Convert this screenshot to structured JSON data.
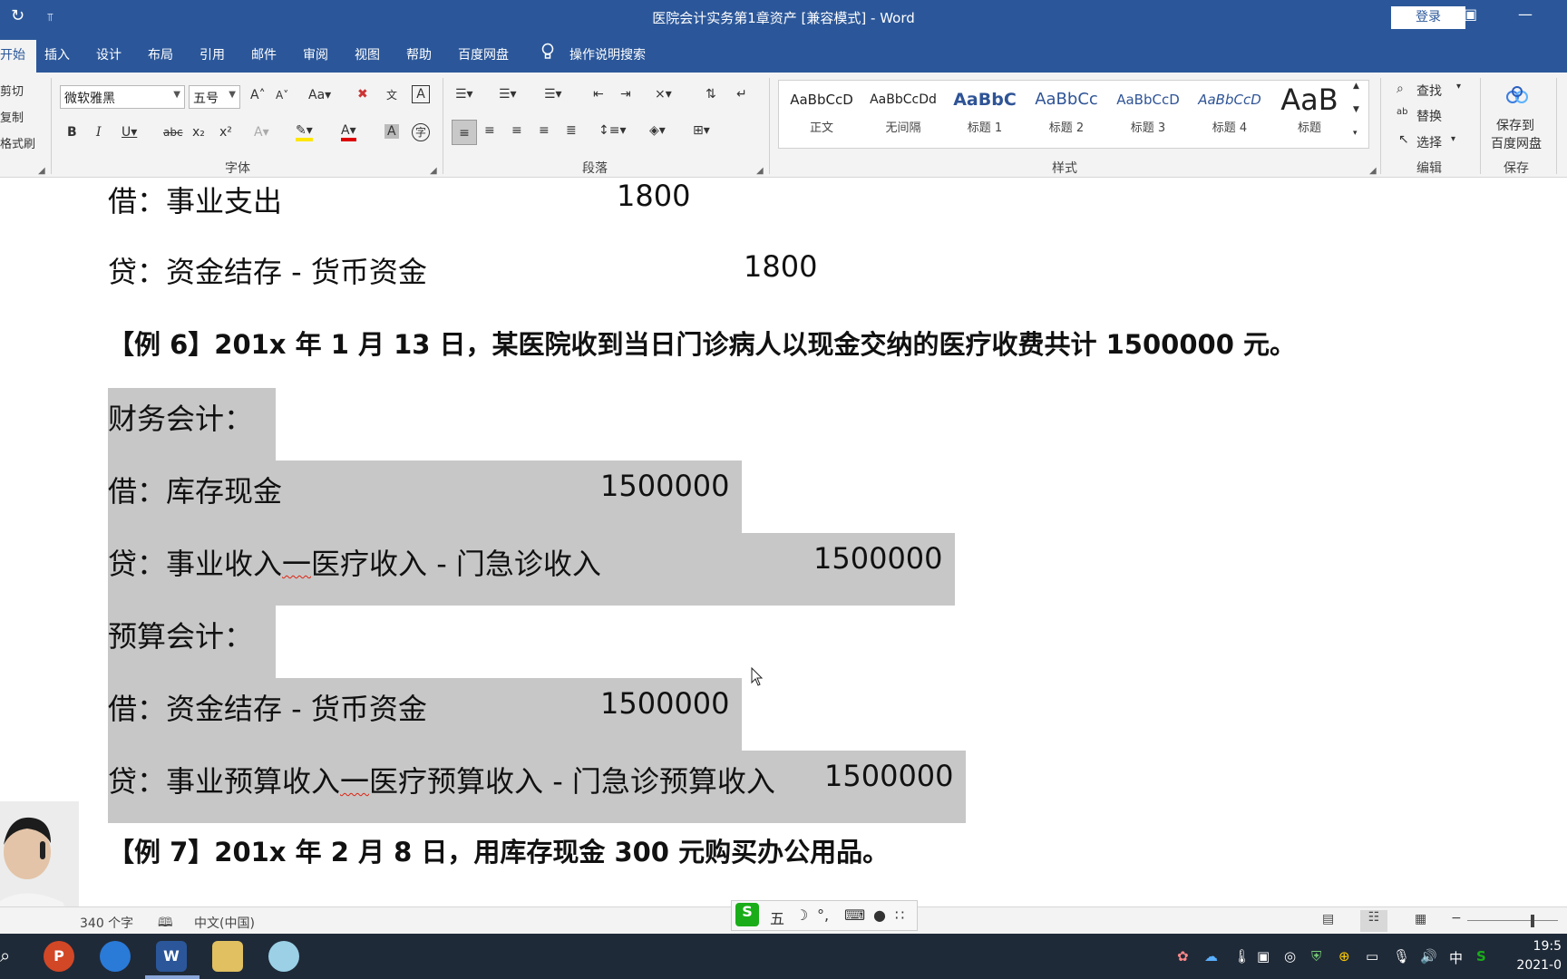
{
  "window": {
    "title": "医院会计实务第1章资产 [兼容模式]  -  Word",
    "login_label": "登录"
  },
  "tabs": [
    {
      "label": "开始"
    },
    {
      "label": "插入"
    },
    {
      "label": "设计"
    },
    {
      "label": "布局"
    },
    {
      "label": "引用"
    },
    {
      "label": "邮件"
    },
    {
      "label": "审阅"
    },
    {
      "label": "视图"
    },
    {
      "label": "帮助"
    },
    {
      "label": "百度网盘"
    }
  ],
  "search_label": "操作说明搜索",
  "clipboard": {
    "cut": "剪切",
    "copy": "复制",
    "format_painter": "格式刷"
  },
  "font": {
    "name": "微软雅黑",
    "size": "五号",
    "group_label": "字体"
  },
  "paragraph": {
    "group_label": "段落"
  },
  "styles": {
    "group_label": "样式",
    "items": [
      {
        "sample": "AaBbCcD",
        "name": "正文"
      },
      {
        "sample": "AaBbCcDd",
        "name": "无间隔"
      },
      {
        "sample": "AaBbC",
        "name": "标题 1"
      },
      {
        "sample": "AaBbCc",
        "name": "标题 2"
      },
      {
        "sample": "AaBbCcD",
        "name": "标题 3"
      },
      {
        "sample": "AaBbCcD",
        "name": "标题 4"
      },
      {
        "sample": "AaB",
        "name": "标题"
      }
    ]
  },
  "editing": {
    "find": "查找",
    "replace": "替换",
    "select": "选择",
    "group_label": "编辑"
  },
  "save": {
    "line1": "保存到",
    "line2": "百度网盘",
    "group_label": "保存"
  },
  "document": {
    "line1_text": "借：事业支出",
    "line1_amount": "1800",
    "line2_text": "贷：资金结存 - 货币资金",
    "line2_amount": "1800",
    "example6": "【例 6】201x 年 1 月 13 日，某医院收到当日门诊病人以现金交纳的医疗收费共计 1500000 元。",
    "fin_header": "财务会计：",
    "fin_debit_text": "借：库存现金",
    "fin_debit_amount": "1500000",
    "fin_credit_a": "贷：事业收入",
    "fin_credit_b": "一",
    "fin_credit_c": "医疗收入 - 门急诊收入",
    "fin_credit_amount": "1500000",
    "budget_header": "预算会计：",
    "budget_debit_text": "借：资金结存 - 货币资金",
    "budget_debit_amount": "1500000",
    "budget_credit_a": "贷：事业预算收入",
    "budget_credit_b": "一",
    "budget_credit_c": "医疗预算收入 - 门急诊预算收入",
    "budget_credit_amount": "1500000",
    "example7": "【例 7】201x 年 2 月 8 日，用库存现金 300 元购买办公用品。"
  },
  "status": {
    "word_count": "340 个字",
    "language": "中文(中国)"
  },
  "ime": {
    "mode": "五"
  },
  "tray": {
    "lang": "中"
  },
  "clock": {
    "time": "19:5",
    "date": "2021-0"
  }
}
